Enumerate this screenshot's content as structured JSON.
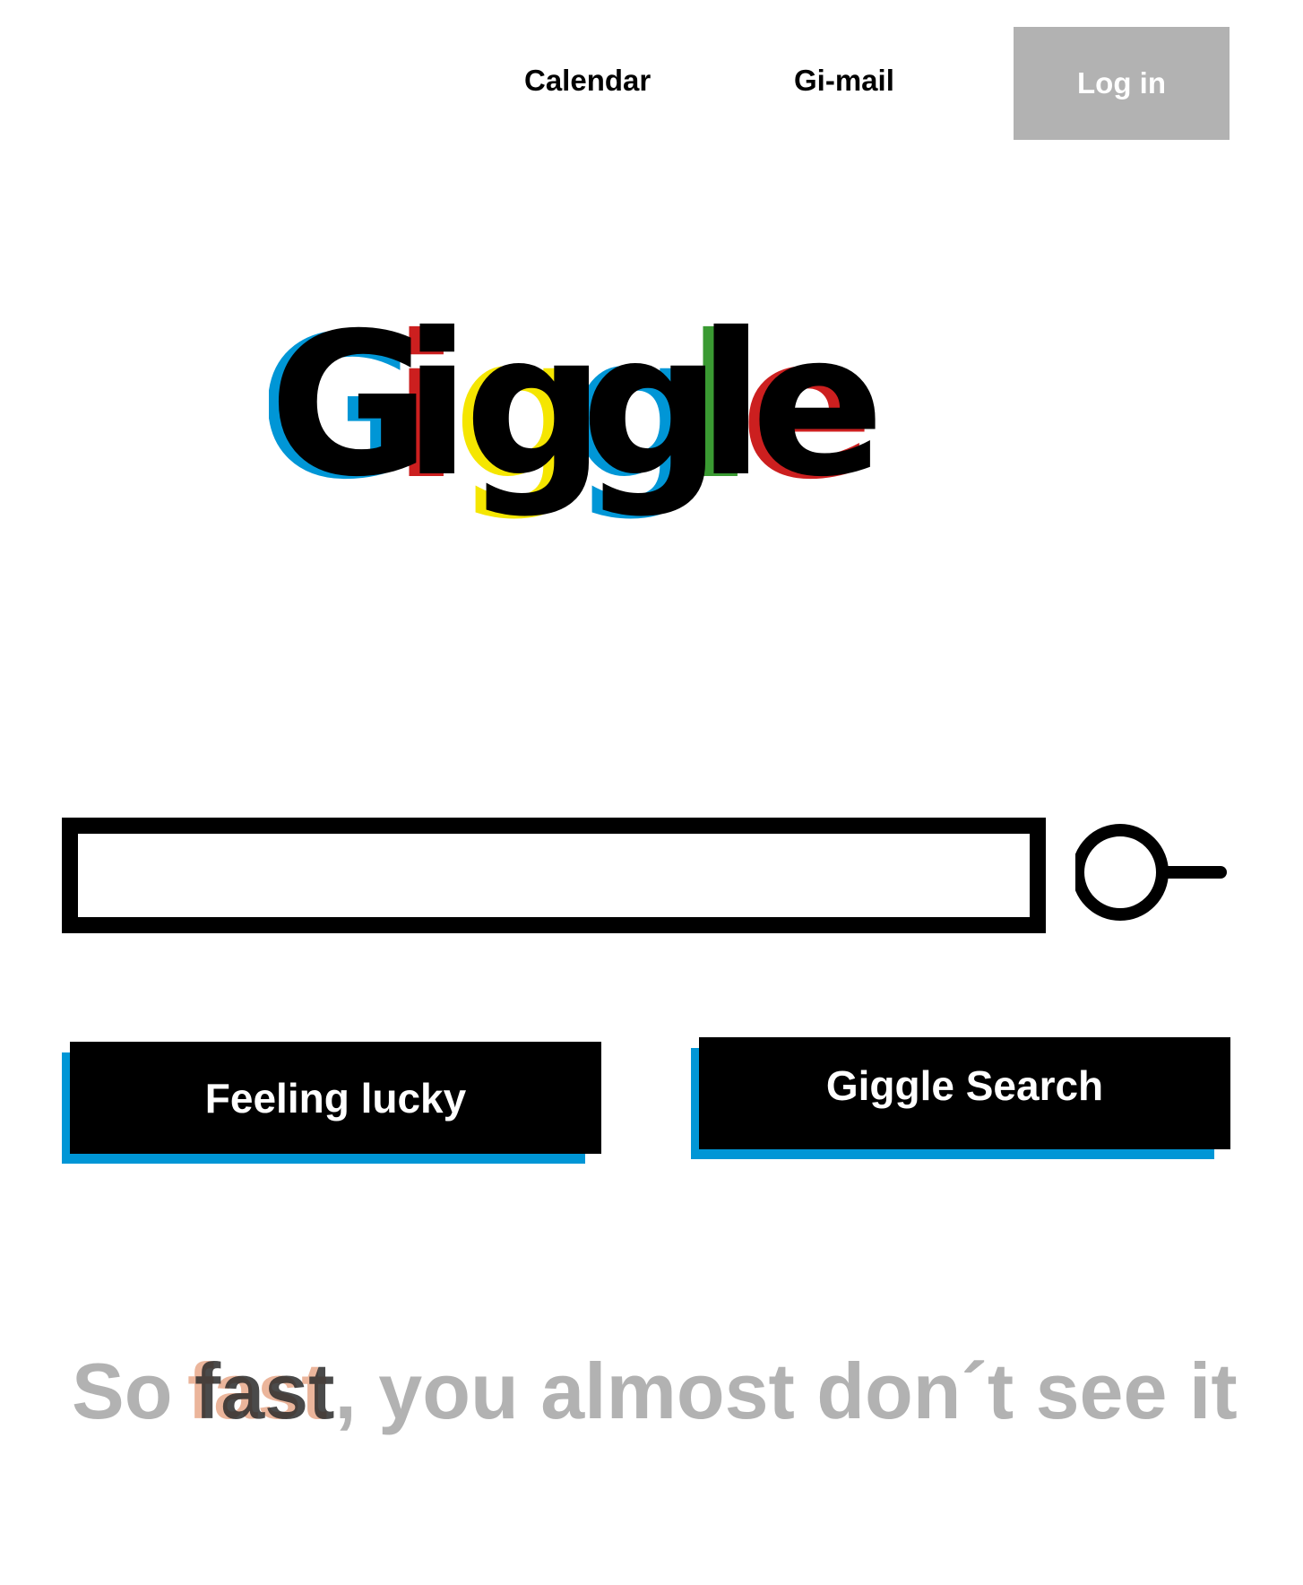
{
  "nav": {
    "calendar_label": "Calendar",
    "gimail_label": "Gi-mail",
    "login_label": "Log in"
  },
  "logo": {
    "text": "Giggle",
    "letter_shadow_colors": [
      "#0096d6",
      "#cc1f1f",
      "#f5e600",
      "#0096d6",
      "#3a9a32",
      "#cc1f1f"
    ]
  },
  "search": {
    "value": "",
    "placeholder": "",
    "icon": "search-icon"
  },
  "buttons": {
    "lucky_label": "Feeling lucky",
    "search_label": "Giggle Search"
  },
  "tagline": {
    "before": "So ",
    "highlight": "fast",
    "after": ", you almost don´t see it"
  },
  "colors": {
    "accent_blue": "#0096d6",
    "muted_gray": "#b2b2b2",
    "text_black": "#000000"
  }
}
